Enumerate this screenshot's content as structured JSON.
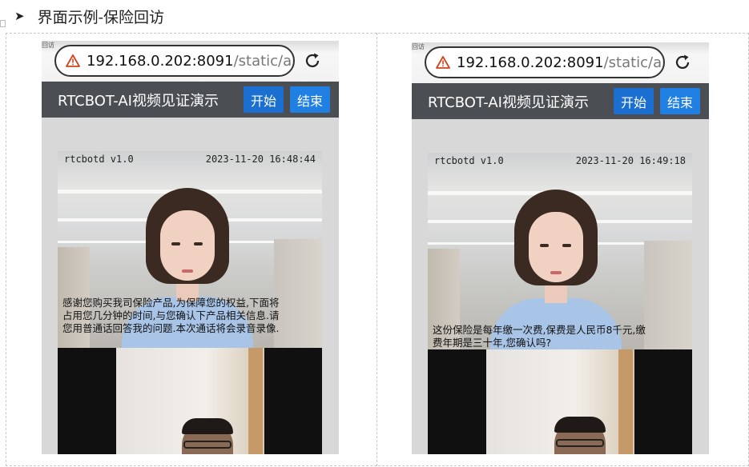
{
  "document": {
    "bullet": "➤",
    "heading": "界面示例-保险回访"
  },
  "icons": {
    "bullet": "arrow-bullet-icon",
    "warning": "warning-triangle-icon",
    "reload": "reload-icon"
  },
  "colors": {
    "app_bar": "#4b4f54",
    "start_button": "#1a6fd1",
    "end_button": "#1f7fe3",
    "warning": "#d0441b"
  },
  "phones": [
    {
      "url_host": "192.168.0.202:8091",
      "url_path": "/static/artc",
      "app_title": "RTCBOT-AI视频见证演示",
      "start_label": "开始",
      "end_label": "结束",
      "overlay_version": "rtcbotd v1.0",
      "overlay_timestamp": "2023-11-20 16:48:44",
      "subtitle": [
        "感谢您购买我司保险产品,为保障您的权益,下面将",
        "占用您几分钟的时间,与您确认下产品相关信息.请",
        "您用普通话回答我的问题.本次通话将会录音录像."
      ]
    },
    {
      "url_host": "192.168.0.202:8091",
      "url_path": "/static/artc",
      "app_title": "RTCBOT-AI视频见证演示",
      "start_label": "开始",
      "end_label": "结束",
      "overlay_version": "rtcbotd v1.0",
      "overlay_timestamp": "2023-11-20 16:49:18",
      "subtitle": [
        "这份保险是每年缴一次费,保费是人民币8千元,缴",
        "费年期是三十年,您确认吗?"
      ]
    }
  ]
}
